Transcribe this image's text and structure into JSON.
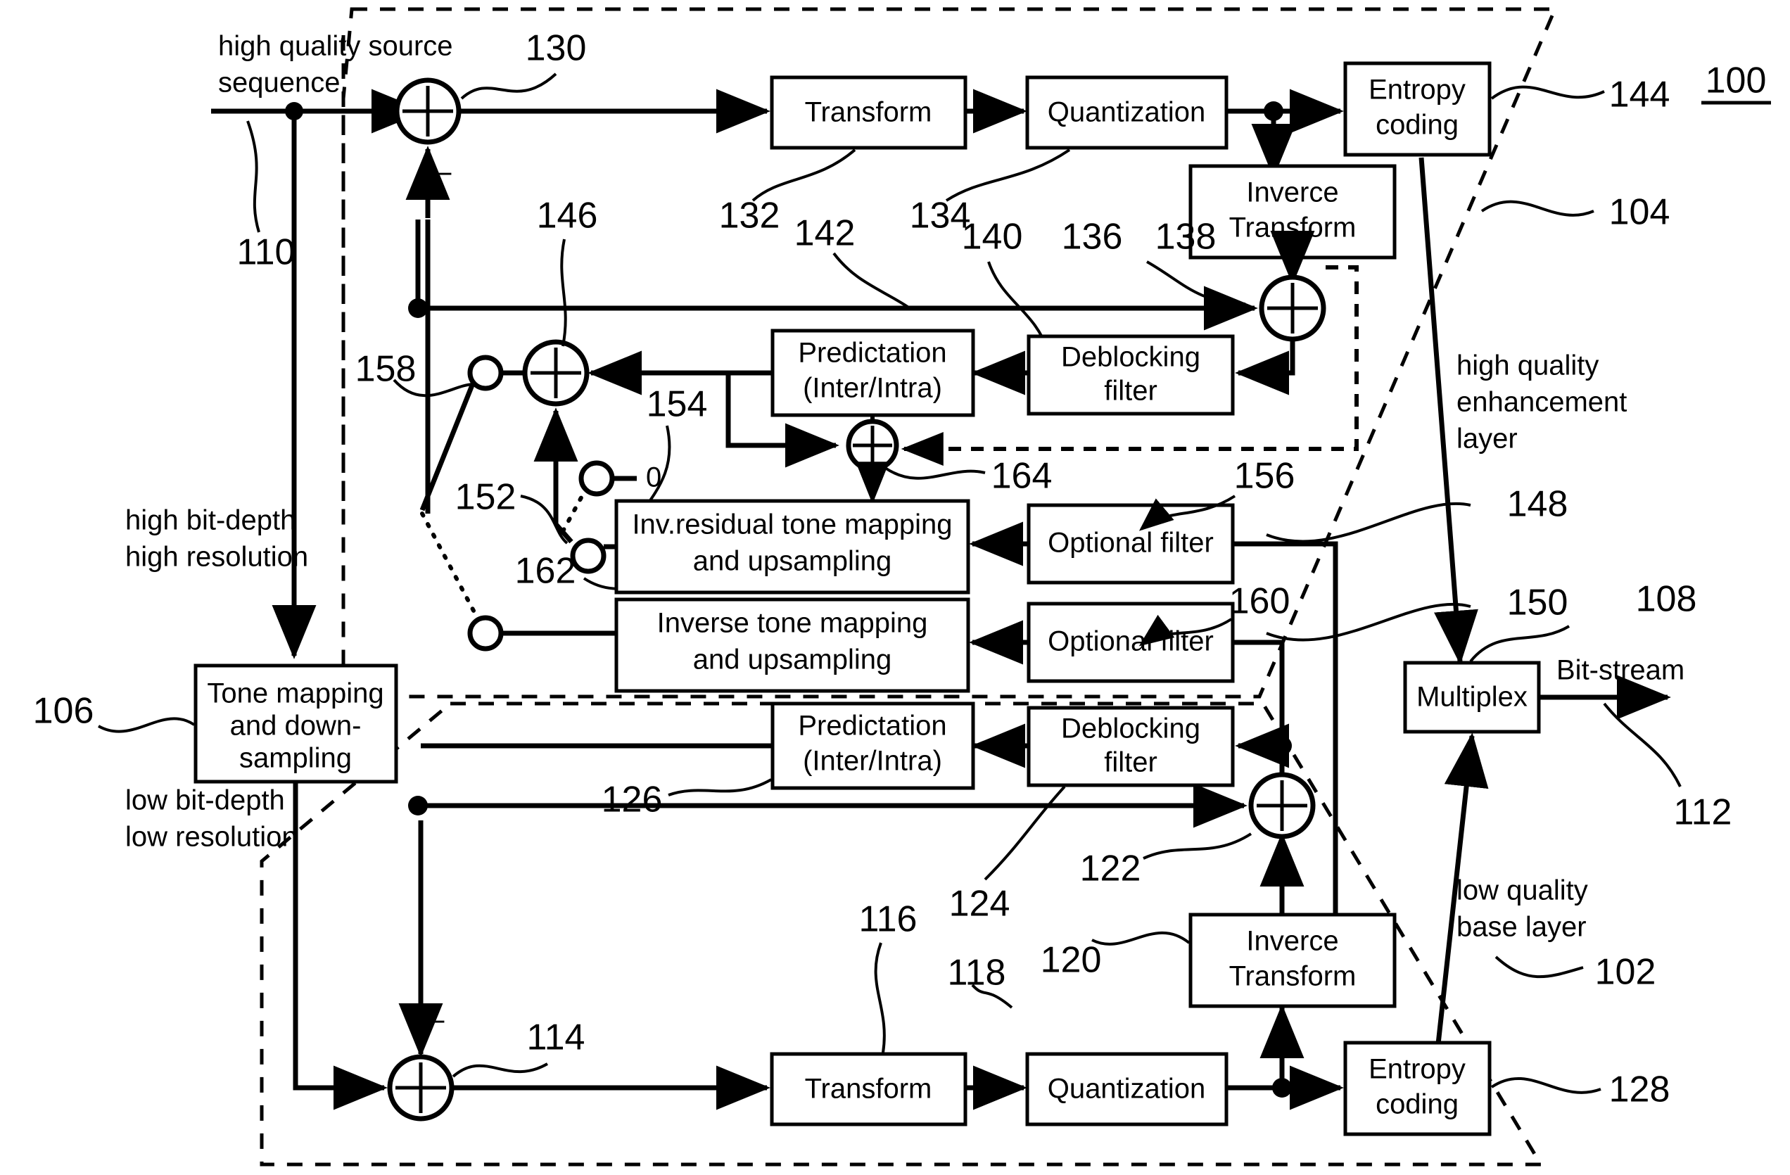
{
  "figure": {
    "number": "100",
    "title_underlined": true
  },
  "boxes": {
    "transform_hi": "Transform",
    "quantization_hi": "Quantization",
    "entropy_hi_line1": "Entropy",
    "entropy_hi_line2": "coding",
    "inverse_transform_hi_line1": "Inverce",
    "inverse_transform_hi_line2": "Transform",
    "prediction_hi_line1": "Predictation",
    "prediction_hi_line2": "(Inter/Intra)",
    "deblocking_hi_line1": "Deblocking",
    "deblocking_hi_line2": "filter",
    "inv_residual_tone_line1": "Inv.residual tone mapping",
    "inv_residual_tone_line2": "and upsampling",
    "inverse_tone_line1": "Inverse tone mapping",
    "inverse_tone_line2": "and upsampling",
    "optional_filter_top": "Optional filter",
    "optional_filter_bottom": "Optional filter",
    "tone_mapping_line1": "Tone mapping",
    "tone_mapping_line2": "and down-",
    "tone_mapping_line3": "sampling",
    "multiplex": "Multiplex",
    "prediction_lo_line1": "Predictation",
    "prediction_lo_line2": "(Inter/Intra)",
    "deblocking_lo_line1": "Deblocking",
    "deblocking_lo_line2": "filter",
    "inverse_transform_lo_line1": "Inverce",
    "inverse_transform_lo_line2": "Transform",
    "transform_lo": "Transform",
    "quantization_lo": "Quantization",
    "entropy_lo_line1": "Entropy",
    "entropy_lo_line2": "coding"
  },
  "annotations": {
    "source_line1": "high quality source",
    "source_line2": "sequence",
    "high_bitdepth_line1": "high bit-depth",
    "high_bitdepth_line2": "high resolution",
    "low_bitdepth_line1": "low bit-depth",
    "low_bitdepth_line2": "low resolution",
    "hq_enh_line1": "high quality",
    "hq_enh_line2": "enhancement",
    "hq_enh_line3": "layer",
    "lq_base_line1": "low quality",
    "lq_base_line2": "base layer",
    "bitstream": "Bit-stream",
    "switch_zero": "0",
    "minus_sign": "−"
  },
  "reference_numerals": {
    "n100": "100",
    "n102": "102",
    "n104": "104",
    "n106": "106",
    "n108": "108",
    "n110": "110",
    "n112": "112",
    "n114": "114",
    "n116": "116",
    "n118": "118",
    "n120": "120",
    "n122": "122",
    "n124": "124",
    "n126": "126",
    "n128": "128",
    "n130": "130",
    "n132": "132",
    "n134": "134",
    "n136": "136",
    "n138": "138",
    "n140": "140",
    "n142": "142",
    "n144": "144",
    "n146": "146",
    "n148": "148",
    "n150": "150",
    "n152": "152",
    "n154": "154",
    "n156": "156",
    "n158": "158",
    "n160": "160",
    "n162": "162",
    "n164": "164"
  }
}
